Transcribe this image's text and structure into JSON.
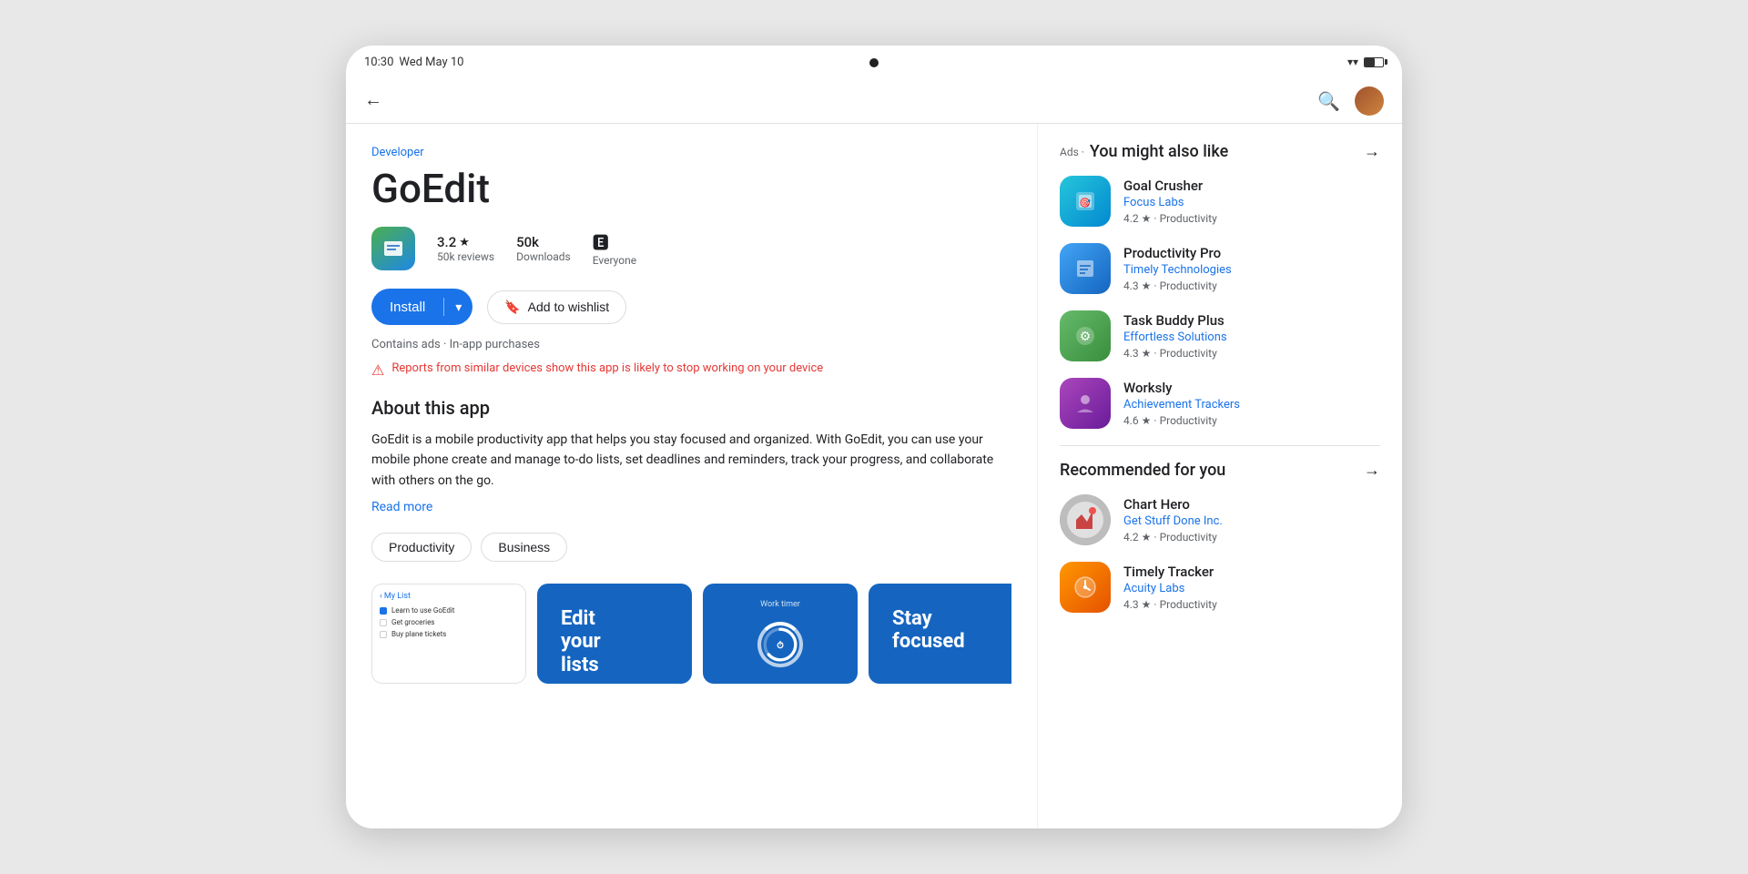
{
  "device": {
    "time": "10:30",
    "date": "Wed May 10",
    "camera": true
  },
  "nav": {
    "back_icon": "←",
    "search_icon": "🔍",
    "arrow_icon": "→"
  },
  "app": {
    "developer": "Developer",
    "title": "GoEdit",
    "rating_value": "3.2",
    "rating_star": "★",
    "reviews": "50k reviews",
    "downloads": "50k",
    "downloads_label": "Downloads",
    "age_rating": "Everyone",
    "install_label": "Install",
    "install_arrow": "▾",
    "wishlist_label": "Add to wishlist",
    "wishlist_icon": "🔖",
    "contains_ads": "Contains ads · In-app purchases",
    "warning_text": "Reports from similar devices show this app is likely to stop working on your device",
    "about_title": "About this app",
    "about_text": "GoEdit is a mobile productivity app that helps you stay focused and organized. With GoEdit, you can use your mobile phone create and manage to-do lists, set deadlines and reminders, track your progress, and collaborate with others on the go.",
    "read_more": "Read more",
    "tags": [
      "Productivity",
      "Business"
    ],
    "screenshots": [
      {
        "type": "list",
        "header": "My List",
        "items": [
          "Learn to use GoEdit",
          "Get groceries",
          "Buy plane tickets"
        ]
      },
      {
        "type": "text",
        "lines": [
          "Edit",
          "your",
          "lists"
        ]
      },
      {
        "type": "timer",
        "label": "Work timer"
      },
      {
        "type": "text",
        "lines": [
          "Stay",
          "focused"
        ]
      }
    ]
  },
  "sidebar": {
    "ads_label": "Ads ·",
    "you_might_like": "You might also like",
    "recommended_label": "Recommended for you",
    "ads": [
      {
        "name": "Goal Crusher",
        "developer": "Focus Labs",
        "rating": "4.2",
        "category": "Productivity",
        "icon_type": "goal"
      },
      {
        "name": "Productivity Pro",
        "developer": "Timely Technologies",
        "rating": "4.3",
        "category": "Productivity",
        "icon_type": "prodpro"
      },
      {
        "name": "Task Buddy Plus",
        "developer": "Effortless Solutions",
        "rating": "4.3",
        "category": "Productivity",
        "icon_type": "taskbuddy"
      },
      {
        "name": "Worksly",
        "developer": "Achievement Trackers",
        "rating": "4.6",
        "category": "Productivity",
        "icon_type": "worksly"
      }
    ],
    "recommended": [
      {
        "name": "Chart Hero",
        "developer": "Get Stuff Done Inc.",
        "rating": "4.2",
        "category": "Productivity",
        "icon_type": "charthero"
      },
      {
        "name": "Timely Tracker",
        "developer": "Acuity Labs",
        "rating": "4.3",
        "category": "Productivity",
        "icon_type": "timely"
      }
    ]
  }
}
